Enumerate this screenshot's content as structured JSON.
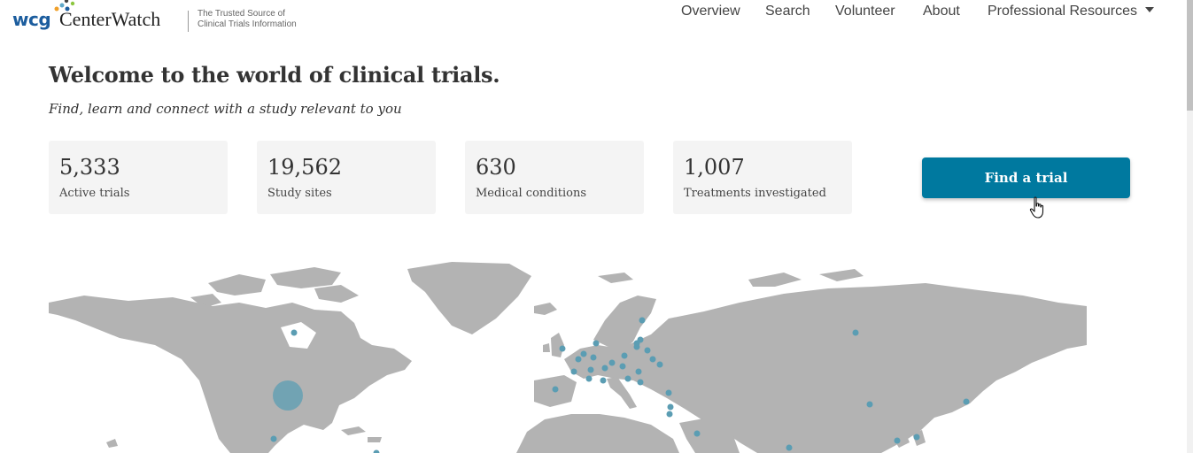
{
  "header": {
    "logo": {
      "wcg": "wcg",
      "brand": "CenterWatch",
      "tagline_line1": "The Trusted Source of",
      "tagline_line2": "Clinical Trials Information"
    },
    "nav": [
      {
        "label": "Overview"
      },
      {
        "label": "Search"
      },
      {
        "label": "Volunteer"
      },
      {
        "label": "About"
      },
      {
        "label": "Professional Resources",
        "has_dropdown": true
      }
    ]
  },
  "hero": {
    "title": "Welcome to the world of clinical trials.",
    "subtitle": "Find, learn and connect with a study relevant to you"
  },
  "stats": [
    {
      "value": "5,333",
      "label": "Active trials"
    },
    {
      "value": "19,562",
      "label": "Study sites"
    },
    {
      "value": "630",
      "label": "Medical conditions"
    },
    {
      "value": "1,007",
      "label": "Treatments investigated"
    }
  ],
  "cta": {
    "label": "Find a trial"
  },
  "colors": {
    "accent": "#00799f",
    "brand_blue": "#1c5d9e",
    "map_land": "#b3b3b3",
    "map_marker": "#5b9db3",
    "stat_bg": "#f4f4f4"
  },
  "icons": {
    "cursor": "hand-pointer-icon",
    "dropdown": "caret-down-icon"
  }
}
